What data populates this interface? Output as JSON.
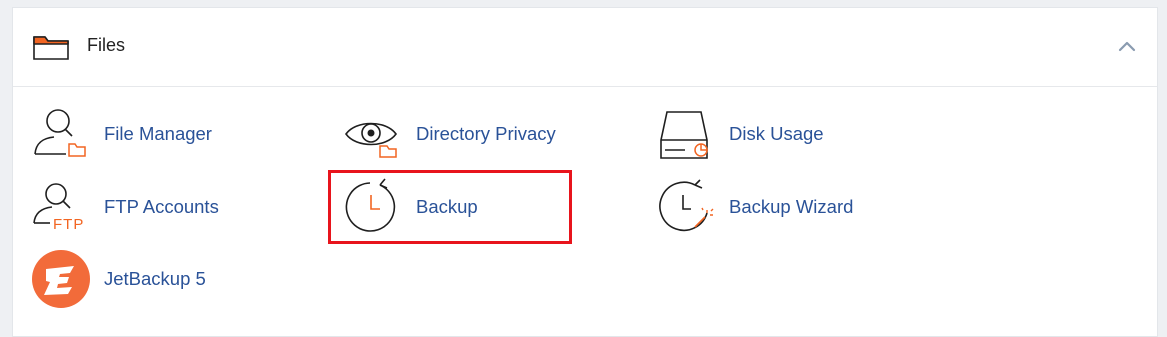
{
  "section": {
    "title": "Files",
    "icon": "folder-icon",
    "collapse_icon": "chevron-up-icon"
  },
  "items": [
    {
      "label": "File Manager",
      "icon": "file-manager-icon"
    },
    {
      "label": "Directory Privacy",
      "icon": "directory-privacy-icon"
    },
    {
      "label": "Disk Usage",
      "icon": "disk-usage-icon"
    },
    {
      "label": "FTP Accounts",
      "icon": "ftp-accounts-icon"
    },
    {
      "label": "Backup",
      "icon": "backup-icon"
    },
    {
      "label": "Backup Wizard",
      "icon": "backup-wizard-icon"
    },
    {
      "label": "JetBackup 5",
      "icon": "jetbackup-icon"
    }
  ],
  "colors": {
    "accent": "#f26522",
    "link": "#2a5298",
    "highlight": "#e8141c",
    "jetbackup": "#f26b3a"
  }
}
